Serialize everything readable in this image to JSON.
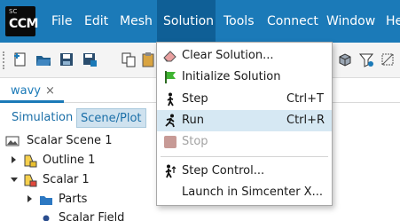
{
  "app": {
    "logo_small": "SC",
    "logo_main": "CCM"
  },
  "menubar": {
    "items": [
      {
        "label": "File"
      },
      {
        "label": "Edit"
      },
      {
        "label": "Mesh"
      },
      {
        "label": "Solution"
      },
      {
        "label": "Tools"
      },
      {
        "label": "Connect"
      },
      {
        "label": "Window"
      },
      {
        "label": "He"
      }
    ],
    "active": "Solution"
  },
  "document_tab": {
    "label": "wavy",
    "close": "×"
  },
  "subtabs": [
    {
      "label": "Simulation"
    },
    {
      "label": "Scene/Plot",
      "active": true
    }
  ],
  "tree": [
    {
      "label": "Scalar Scene 1"
    },
    {
      "label": "Outline 1"
    },
    {
      "label": "Scalar 1"
    },
    {
      "label": "Parts"
    },
    {
      "label": "Scalar Field"
    }
  ],
  "solution_menu": {
    "items": [
      {
        "label": "Clear Solution...",
        "shortcut": "",
        "icon": "eraser-icon"
      },
      {
        "label": "Initialize Solution",
        "shortcut": "",
        "icon": "flag-icon"
      },
      {
        "label": "Step",
        "shortcut": "Ctrl+T",
        "icon": "walking-icon"
      },
      {
        "label": "Run",
        "shortcut": "Ctrl+R",
        "icon": "running-icon"
      },
      {
        "label": "Stop",
        "shortcut": "",
        "icon": "stop-icon",
        "disabled": true
      },
      {
        "label": "Step Control...",
        "shortcut": "",
        "icon": "step-control-icon"
      },
      {
        "label": "Launch in Simcenter X...",
        "shortcut": ""
      }
    ]
  },
  "colors": {
    "menubar": "#1b7ab8",
    "menubar_active": "#0f5f96",
    "hover": "#d6e8f3",
    "accent": "#1b7ab8"
  }
}
